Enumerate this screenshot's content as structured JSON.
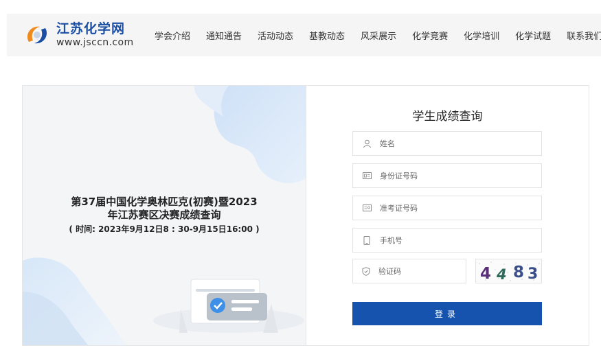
{
  "site": {
    "title": "江苏化学网",
    "url": "www.jsccn.com"
  },
  "nav": {
    "items": [
      {
        "label": "学会介绍"
      },
      {
        "label": "通知通告"
      },
      {
        "label": "活动动态"
      },
      {
        "label": "基教动态"
      },
      {
        "label": "风采展示"
      },
      {
        "label": "化学竞赛"
      },
      {
        "label": "化学培训"
      },
      {
        "label": "化学试题"
      },
      {
        "label": "联系我们"
      }
    ]
  },
  "event": {
    "title_line1": "第37届中国化学奥林匹克(初赛)暨2023",
    "title_line2": "年江苏赛区决赛成绩查询",
    "time": "( 时间: 2023年9月12日8 : 30-9月15日16:00 )"
  },
  "form": {
    "title": "学生成绩查询",
    "fields": {
      "name": {
        "placeholder": "姓名",
        "icon": "user-icon"
      },
      "id_number": {
        "placeholder": "身份证号码",
        "icon": "id-card-icon"
      },
      "exam_number": {
        "placeholder": "准考证号码",
        "icon": "admission-card-icon"
      },
      "phone": {
        "placeholder": "手机号",
        "icon": "phone-icon"
      },
      "captcha": {
        "placeholder": "验证码",
        "icon": "shield-icon"
      }
    },
    "captcha_code": "4483",
    "submit_label": "登录"
  },
  "colors": {
    "brand_blue": "#1553ae",
    "logo_blue": "#1a4fa3",
    "logo_orange": "#f08a1c",
    "header_bg": "#f5f5f6"
  }
}
